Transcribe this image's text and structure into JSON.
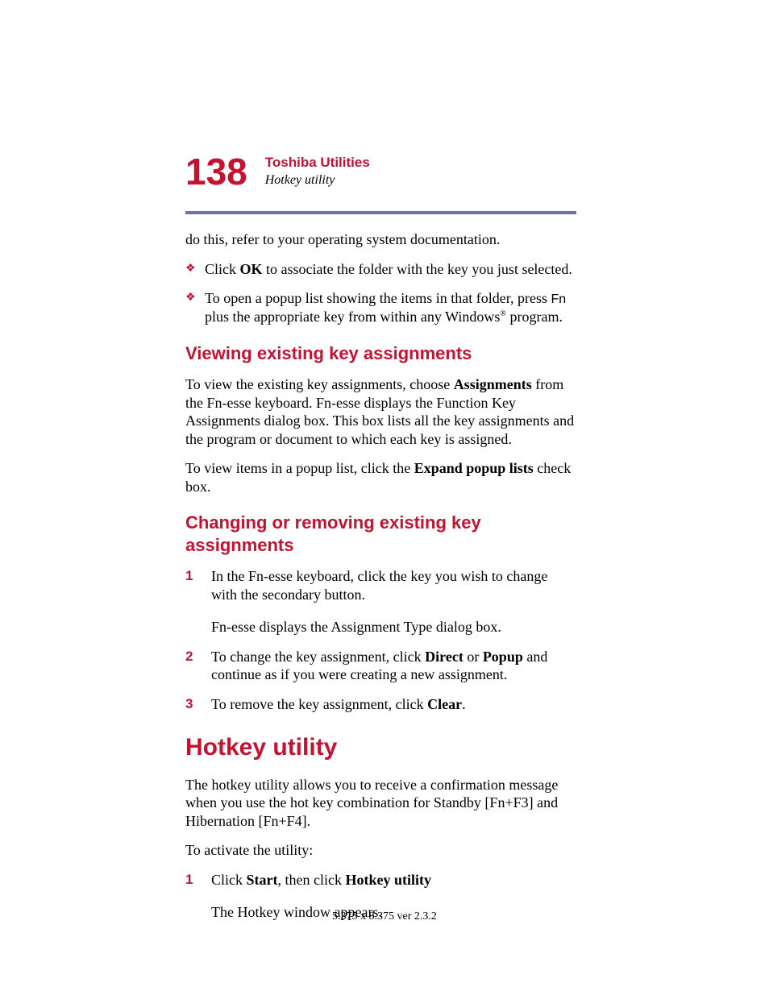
{
  "header": {
    "page_number": "138",
    "chapter": "Toshiba Utilities",
    "section": "Hotkey utility"
  },
  "intro_tail": "do this, refer to your operating system documentation.",
  "bullets": [
    {
      "pre": "Click ",
      "bold": "OK",
      "post": " to associate the folder with the key you just selected."
    },
    {
      "pre": "To open a popup list showing the items in that folder, press ",
      "fn": "Fn",
      "mid": " plus the appropriate key from within any Windows",
      "sup": "®",
      "post": " program."
    }
  ],
  "viewing": {
    "heading": "Viewing existing key assignments",
    "p1_a": "To view the existing key assignments, choose ",
    "p1_b": "Assignments",
    "p1_c": " from the Fn-esse keyboard. Fn-esse displays the Function Key Assignments dialog box. This box lists all the key assignments and the program or document to which each key is assigned.",
    "p2_a": "To view items in a popup list, click the ",
    "p2_b": "Expand popup lists",
    "p2_c": " check box."
  },
  "changing": {
    "heading": "Changing or removing existing key assignments",
    "steps": [
      {
        "num": "1",
        "text": "In the Fn-esse keyboard, click the key you wish to change with the secondary button.",
        "sub": "Fn-esse displays the Assignment Type dialog box."
      },
      {
        "num": "2",
        "pre": "To change the key assignment, click ",
        "b1": "Direct",
        "mid": " or ",
        "b2": "Popup",
        "post": " and continue as if you were creating a new assignment."
      },
      {
        "num": "3",
        "pre": "To remove the key assignment, click ",
        "b1": "Clear",
        "post": "."
      }
    ]
  },
  "hotkey": {
    "heading": "Hotkey utility",
    "p1": "The hotkey utility allows you to receive a confirmation message when you use the hot key combination for Standby [Fn+F3] and Hibernation [Fn+F4].",
    "p2": "To activate the utility:",
    "step1": {
      "num": "1",
      "pre": "Click ",
      "b1": "Start",
      "mid": ", then click ",
      "b2": "Hotkey utility",
      "sub": "The Hotkey window appears."
    }
  },
  "footer": "5.375 x 8.375 ver 2.3.2"
}
